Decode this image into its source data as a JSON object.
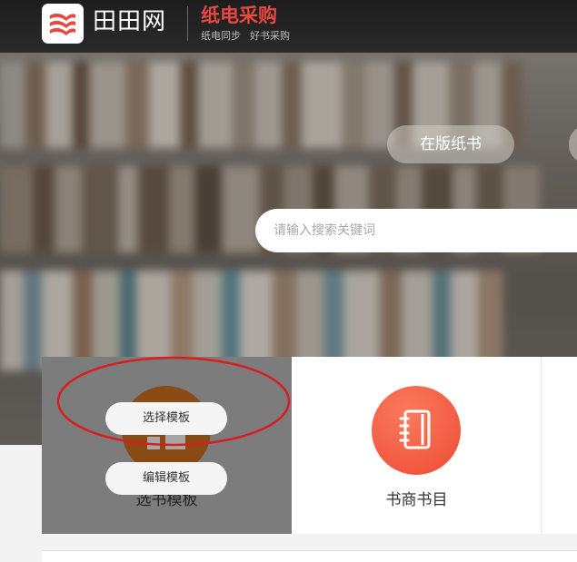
{
  "header": {
    "brand": "田田网",
    "subtitle": "纸电采购",
    "tags": [
      "纸电同步",
      "好书采购"
    ],
    "logo_icon": "stacked-books-logo-icon",
    "accent_color": "#e8483f"
  },
  "hero": {
    "pill_label": "在版纸书",
    "search_placeholder": "请输入搜索关键词"
  },
  "cards": [
    {
      "label": "选书模板",
      "icon": "template-icon",
      "overlay_buttons": [
        "选择模板",
        "编辑模板"
      ]
    },
    {
      "label": "书商书目",
      "icon": "notebook-icon"
    }
  ]
}
